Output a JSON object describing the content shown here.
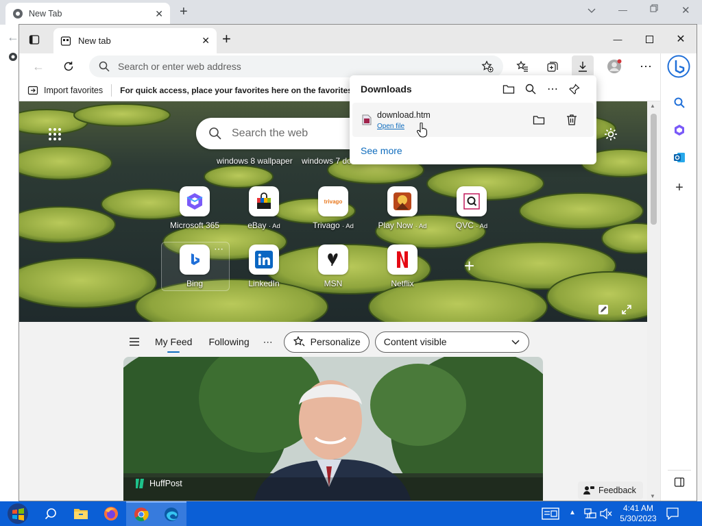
{
  "chrome": {
    "tab_title": "New Tab"
  },
  "edge": {
    "tab_title": "New tab",
    "address_placeholder": "Search or enter web address",
    "favorites": {
      "import_label": "Import favorites",
      "hint": "For quick access, place your favorites here on the favorites bar"
    }
  },
  "downloads": {
    "title": "Downloads",
    "item": {
      "filename": "download.htm",
      "action": "Open file"
    },
    "see_more": "See more"
  },
  "newtab": {
    "search_placeholder": "Search the web",
    "trending": [
      "windows 8 wallpaper",
      "windows 7 do"
    ],
    "quick_links_row1": [
      {
        "name": "Microsoft 365",
        "ad": ""
      },
      {
        "name": "eBay",
        "ad": "· Ad"
      },
      {
        "name": "Trivago",
        "ad": "· Ad"
      },
      {
        "name": "Play Now",
        "ad": "· Ad"
      },
      {
        "name": "QVC",
        "ad": "· Ad"
      }
    ],
    "quick_links_row2": [
      {
        "name": "Bing",
        "ad": ""
      },
      {
        "name": "LinkedIn",
        "ad": ""
      },
      {
        "name": "MSN",
        "ad": ""
      },
      {
        "name": "Netflix",
        "ad": ""
      }
    ],
    "trivago_logo_text": "trivago",
    "feed": {
      "tabs": [
        "My Feed",
        "Following"
      ],
      "personalize": "Personalize",
      "content_visible": "Content visible",
      "card_source": "HuffPost"
    },
    "feedback": "Feedback"
  },
  "taskbar": {
    "time": "4:41 AM",
    "date": "5/30/2023"
  },
  "colors": {
    "accent": "#0f6cbd",
    "taskbar": "#0b5fd6"
  }
}
